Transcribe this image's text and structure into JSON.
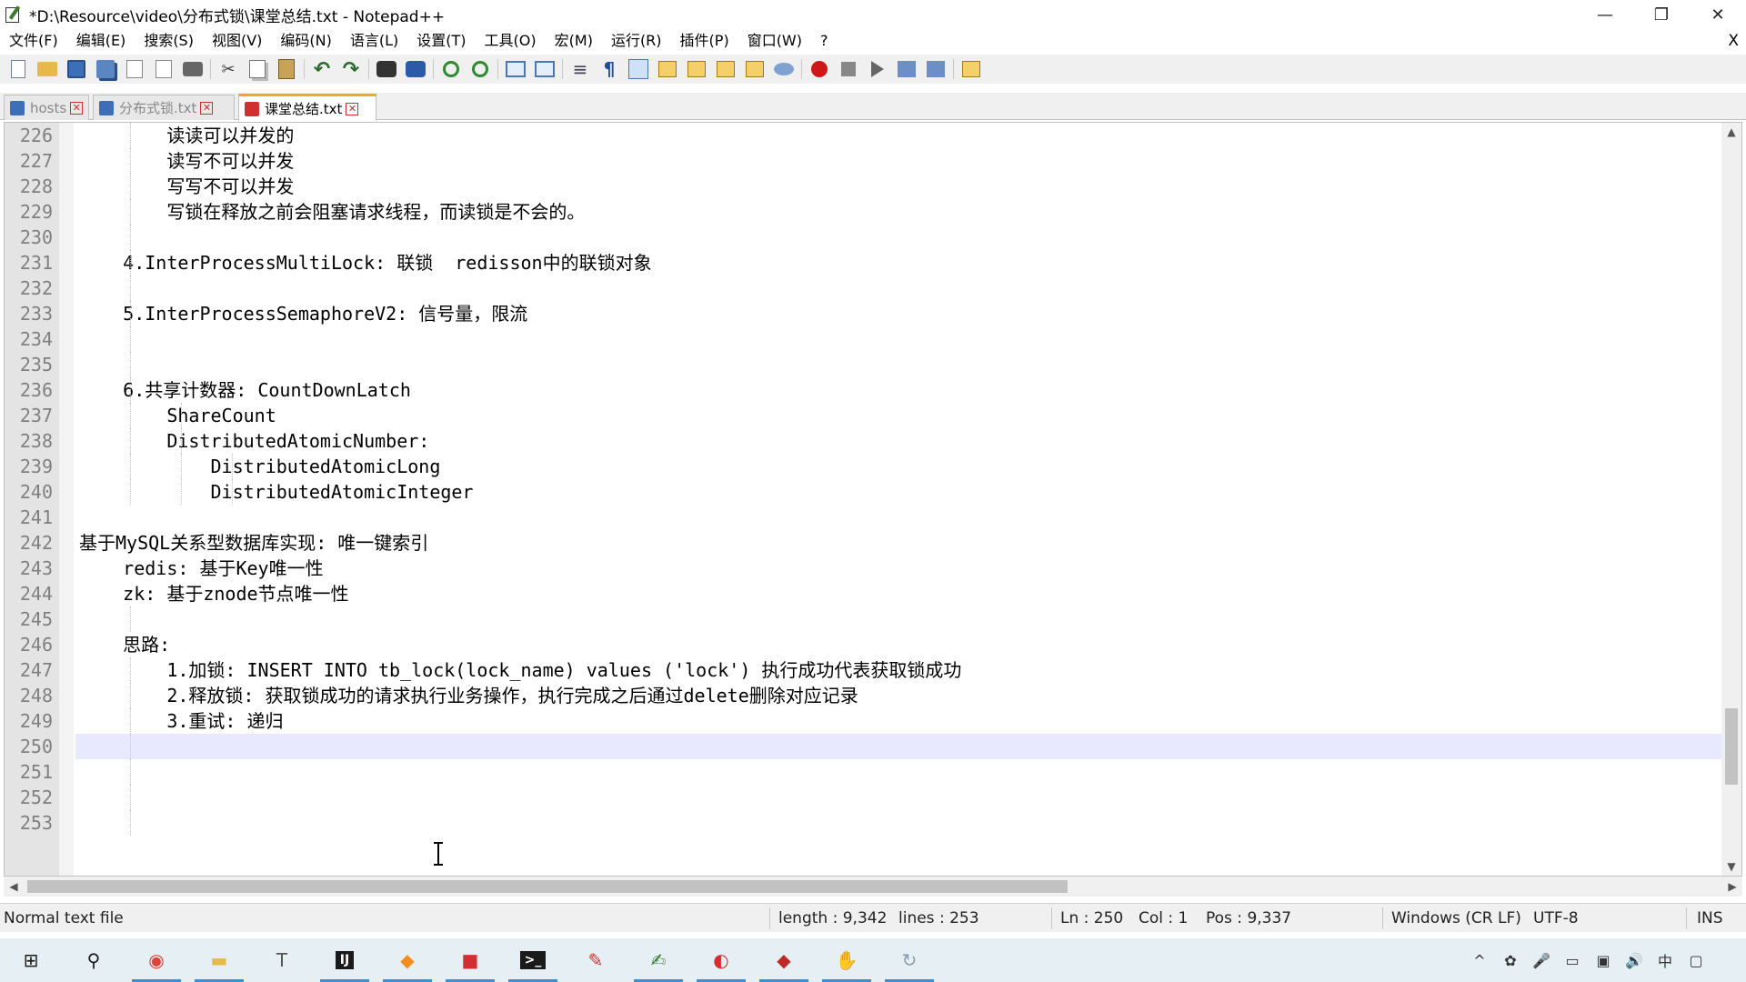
{
  "window": {
    "title": "*D:\\Resource\\video\\分布式锁\\课堂总结.txt - Notepad++",
    "controls": {
      "minimize": "—",
      "maximize": "❐",
      "close": "✕"
    }
  },
  "menu": {
    "items": [
      "文件(F)",
      "编辑(E)",
      "搜索(S)",
      "视图(V)",
      "编码(N)",
      "语言(L)",
      "设置(T)",
      "工具(O)",
      "宏(M)",
      "运行(R)",
      "插件(P)",
      "窗口(W)",
      "?"
    ],
    "close_label": "X"
  },
  "toolbar": {
    "icons": [
      "new-file-icon",
      "open-file-icon",
      "save-icon",
      "save-all-icon",
      "close-icon",
      "close-all-icon",
      "print-icon",
      "cut-icon",
      "copy-icon",
      "paste-icon",
      "undo-icon",
      "redo-icon",
      "find-icon",
      "replace-icon",
      "zoom-in-icon",
      "zoom-out-icon",
      "sync-vertical-icon",
      "sync-horizontal-icon",
      "word-wrap-icon",
      "show-all-chars-icon",
      "indent-guide-icon",
      "user-language-icon",
      "doc-map-icon",
      "function-list-icon",
      "folder-workspace-icon",
      "monitoring-icon",
      "record-macro-icon",
      "stop-recording-icon",
      "play-macro-icon",
      "run-macro-multiple-icon",
      "save-macro-icon",
      "plugin-icon"
    ]
  },
  "tabs": [
    {
      "label": "hosts",
      "state": "saved",
      "active": false
    },
    {
      "label": "分布式锁.txt",
      "state": "saved",
      "active": false
    },
    {
      "label": "课堂总结.txt",
      "state": "unsaved",
      "active": true
    }
  ],
  "editor": {
    "current_line": 250,
    "lines": [
      {
        "num": "226",
        "text": "        读读可以并发的",
        "guides": [
          1
        ]
      },
      {
        "num": "227",
        "text": "        读写不可以并发",
        "guides": [
          1
        ]
      },
      {
        "num": "228",
        "text": "        写写不可以并发",
        "guides": [
          1
        ]
      },
      {
        "num": "229",
        "text": "        写锁在释放之前会阻塞请求线程，而读锁是不会的。",
        "guides": [
          1
        ]
      },
      {
        "num": "230",
        "text": "",
        "guides": [
          1
        ]
      },
      {
        "num": "231",
        "text": "    4.InterProcessMultiLock: 联锁  redisson中的联锁对象",
        "guides": [
          1
        ]
      },
      {
        "num": "232",
        "text": "",
        "guides": [
          1
        ]
      },
      {
        "num": "233",
        "text": "    5.InterProcessSemaphoreV2: 信号量，限流",
        "guides": [
          1
        ]
      },
      {
        "num": "234",
        "text": "",
        "guides": [
          1
        ]
      },
      {
        "num": "235",
        "text": "",
        "guides": [
          1
        ]
      },
      {
        "num": "236",
        "text": "    6.共享计数器: CountDownLatch",
        "guides": [
          1
        ]
      },
      {
        "num": "237",
        "text": "        ShareCount",
        "guides": [
          1,
          2
        ]
      },
      {
        "num": "238",
        "text": "        DistributedAtomicNumber:",
        "guides": [
          1,
          2
        ]
      },
      {
        "num": "239",
        "text": "            DistributedAtomicLong",
        "guides": [
          1,
          2,
          3
        ]
      },
      {
        "num": "240",
        "text": "            DistributedAtomicInteger",
        "guides": [
          1,
          2,
          3
        ]
      },
      {
        "num": "241",
        "text": "",
        "guides": []
      },
      {
        "num": "242",
        "text": "基于MySQL关系型数据库实现: 唯一键索引",
        "guides": []
      },
      {
        "num": "243",
        "text": "    redis: 基于Key唯一性",
        "guides": []
      },
      {
        "num": "244",
        "text": "    zk: 基于znode节点唯一性",
        "guides": []
      },
      {
        "num": "245",
        "text": "",
        "guides": [
          1
        ]
      },
      {
        "num": "246",
        "text": "    思路:",
        "guides": []
      },
      {
        "num": "247",
        "text": "        1.加锁: INSERT INTO tb_lock(lock_name) values ('lock') 执行成功代表获取锁成功",
        "guides": [
          1
        ]
      },
      {
        "num": "248",
        "text": "        2.释放锁: 获取锁成功的请求执行业务操作，执行完成之后通过delete删除对应记录",
        "guides": [
          1
        ]
      },
      {
        "num": "249",
        "text": "        3.重试: 递归",
        "guides": [
          1
        ]
      },
      {
        "num": "250",
        "text": "",
        "guides": [
          1
        ]
      },
      {
        "num": "251",
        "text": "",
        "guides": [
          1
        ]
      },
      {
        "num": "252",
        "text": "",
        "guides": [
          1
        ]
      },
      {
        "num": "253",
        "text": "",
        "guides": [
          1
        ]
      }
    ]
  },
  "status": {
    "file_type": "Normal text file",
    "length": "length : 9,342",
    "lines": "lines : 253",
    "ln": "Ln : 250",
    "col": "Col : 1",
    "pos": "Pos : 9,337",
    "eol": "Windows (CR LF)",
    "encoding": "UTF-8",
    "mode": "INS"
  },
  "taskbar": {
    "apps": [
      {
        "name": "start-icon",
        "glyph": "⊞",
        "color": "#1a1a1a"
      },
      {
        "name": "search-icon",
        "glyph": "⚲",
        "color": "#1a1a1a"
      },
      {
        "name": "chrome-icon",
        "glyph": "◉",
        "color": "#db4437"
      },
      {
        "name": "file-explorer-icon",
        "glyph": "▬",
        "color": "#e8b84a"
      },
      {
        "name": "typora-icon",
        "glyph": "T",
        "color": "#555555"
      },
      {
        "name": "intellij-icon",
        "glyph": "IJ",
        "color": "#ffffff"
      },
      {
        "name": "app-orange-icon",
        "glyph": "◆",
        "color": "#f28c1c"
      },
      {
        "name": "app-red-icon",
        "glyph": "■",
        "color": "#d03030"
      },
      {
        "name": "terminal-icon",
        "glyph": ">_",
        "color": "#ffffff"
      },
      {
        "name": "pen-icon",
        "glyph": "✎",
        "color": "#d03030"
      },
      {
        "name": "notepadpp-icon",
        "glyph": "✍",
        "color": "#3a7a2c"
      },
      {
        "name": "redis-desktop-icon",
        "glyph": "◐",
        "color": "#d03030"
      },
      {
        "name": "redis-icon",
        "glyph": "◆",
        "color": "#c0282a"
      },
      {
        "name": "app-yellow-icon",
        "glyph": "✋",
        "color": "#f0c020"
      },
      {
        "name": "app-cycle-icon",
        "glyph": "↻",
        "color": "#8aa0b0"
      }
    ],
    "tray": [
      {
        "name": "chevron-up-icon",
        "glyph": "^"
      },
      {
        "name": "app-tray-icon",
        "glyph": "✿"
      },
      {
        "name": "microphone-icon",
        "glyph": "🎤"
      },
      {
        "name": "battery-icon",
        "glyph": "▭"
      },
      {
        "name": "network-icon",
        "glyph": "▣"
      },
      {
        "name": "volume-icon",
        "glyph": "🔊"
      },
      {
        "name": "ime-icon",
        "glyph": "中"
      },
      {
        "name": "notification-icon",
        "glyph": "▢"
      }
    ]
  }
}
